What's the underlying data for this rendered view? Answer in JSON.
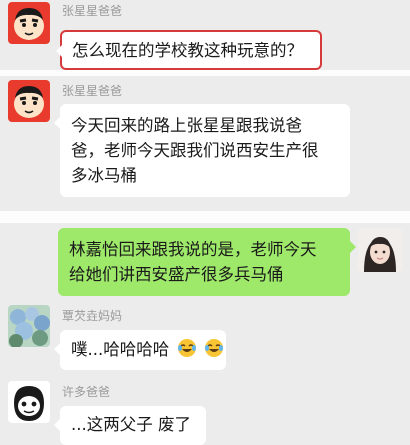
{
  "messages": [
    {
      "sender": "张星星爸爸",
      "lines": [
        "怎么现在的学校教这种玩意的？"
      ],
      "highlighted": true
    },
    {
      "sender": "张星星爸爸",
      "lines": [
        "今天回来的路上张星星跟我说爸",
        "爸，老师今天跟我们说西安生产很",
        "多冰马桶"
      ]
    },
    {
      "lines": [
        "林嘉怡回来跟我说的是，老师今天",
        "给她们讲西安盛产很多兵马俑"
      ],
      "self": true
    },
    {
      "sender": "覃芡垚妈妈",
      "text": "噗...哈哈哈哈",
      "emoji": [
        "laughing-tears-emoji",
        "laughing-tears-emoji"
      ]
    },
    {
      "sender": "许多爸爸",
      "text": "...这两父子 废了"
    }
  ],
  "colors": {
    "background": "#ececec",
    "bubble": "#ffffff",
    "self_bubble": "#9ee86a",
    "highlight": "#d73a3a",
    "name": "#9a9a9a"
  }
}
